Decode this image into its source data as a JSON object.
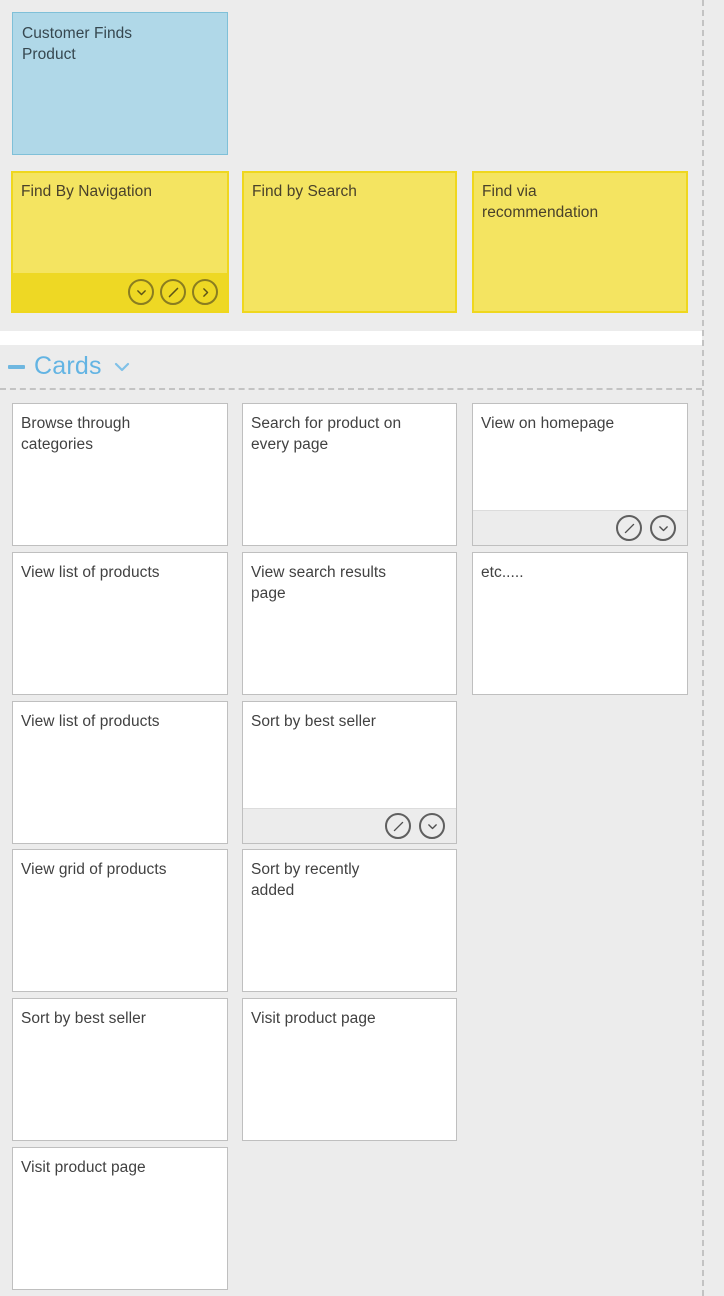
{
  "board": {
    "background_color": "#ececec",
    "divider_color": "#c3c3c3"
  },
  "top_lane": {
    "goal_card": {
      "title": "Customer Finds\nProduct",
      "color": "#b0d8e8",
      "border_color": "#7fc0d8"
    },
    "story_cards": [
      {
        "title": "Find By Navigation",
        "color": "#f4e461",
        "border_color": "#efd71e",
        "has_toolbar": true,
        "toolbar_icons": [
          "chevron-down-icon",
          "edit-icon",
          "chevron-right-icon"
        ]
      },
      {
        "title": "Find by Search",
        "color": "#f4e461",
        "border_color": "#efd71e",
        "has_toolbar": false,
        "toolbar_icons": []
      },
      {
        "title": "Find via\nrecommendation",
        "color": "#f4e461",
        "border_color": "#efd71e",
        "has_toolbar": false,
        "toolbar_icons": []
      }
    ]
  },
  "cards_section": {
    "header": {
      "label": "Cards",
      "collapse_icon": "minus-icon",
      "chevron_icon": "chevron-down-icon",
      "accent_color": "#63b4e3"
    },
    "columns": [
      {
        "index": 0,
        "cards": [
          {
            "title": "Browse through\ncategories",
            "has_toolbar": false,
            "toolbar_icons": []
          },
          {
            "title": "View list of products",
            "has_toolbar": false,
            "toolbar_icons": []
          },
          {
            "title": "View list of products",
            "has_toolbar": false,
            "toolbar_icons": []
          },
          {
            "title": "View grid of products",
            "has_toolbar": false,
            "toolbar_icons": []
          },
          {
            "title": "Sort by best seller",
            "has_toolbar": false,
            "toolbar_icons": []
          },
          {
            "title": "Visit product page",
            "has_toolbar": false,
            "toolbar_icons": []
          }
        ]
      },
      {
        "index": 1,
        "cards": [
          {
            "title": "Search for product on\nevery page",
            "has_toolbar": false,
            "toolbar_icons": []
          },
          {
            "title": "View search results\npage",
            "has_toolbar": false,
            "toolbar_icons": []
          },
          {
            "title": "Sort by best seller",
            "has_toolbar": true,
            "toolbar_icons": [
              "edit-icon",
              "chevron-down-icon"
            ]
          },
          {
            "title": "Sort by recently\nadded",
            "has_toolbar": false,
            "toolbar_icons": []
          },
          {
            "title": "Visit product page",
            "has_toolbar": false,
            "toolbar_icons": []
          }
        ]
      },
      {
        "index": 2,
        "cards": [
          {
            "title": "View on homepage",
            "has_toolbar": true,
            "toolbar_icons": [
              "edit-icon",
              "chevron-down-icon"
            ]
          },
          {
            "title": "etc.....",
            "has_toolbar": false,
            "toolbar_icons": []
          }
        ]
      }
    ]
  }
}
